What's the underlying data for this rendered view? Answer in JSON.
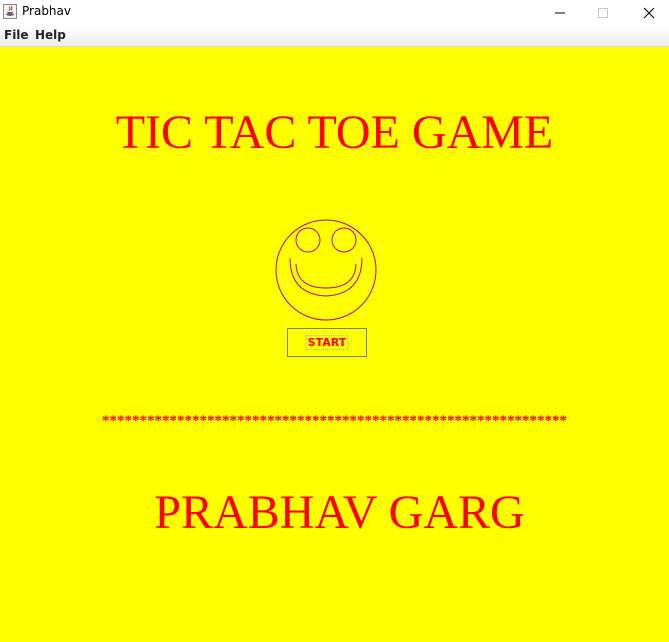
{
  "window": {
    "title": "Prabhav",
    "icon": "java-coffee-cup-icon",
    "controls": [
      "minimize-icon",
      "maximize-icon",
      "close-icon"
    ]
  },
  "menubar": {
    "items": [
      {
        "label": "File"
      },
      {
        "label": "Help"
      }
    ]
  },
  "main": {
    "title": "TIC TAC TOE GAME",
    "smiley_icon": "smiley-face-icon",
    "start_label": "START",
    "separator": "**************************************************************",
    "author": "PRABHAV GARG"
  },
  "colors": {
    "background": "#ffff00",
    "text": "#ff0000",
    "smiley_stroke": "#c0007f"
  }
}
